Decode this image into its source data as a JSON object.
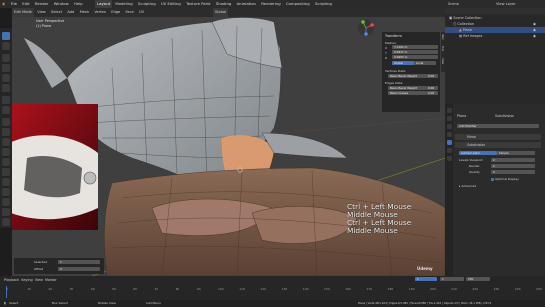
{
  "menu": {
    "items": [
      "File",
      "Edit",
      "Render",
      "Window",
      "Help"
    ],
    "workspaces": [
      "Layout",
      "Modeling",
      "Sculpting",
      "UV Editing",
      "Texture Paint",
      "Shading",
      "Animation",
      "Rendering",
      "Compositing",
      "Scripting"
    ],
    "active_workspace": "Layout",
    "scene": "Scene",
    "view_layer": "View Layer"
  },
  "viewport": {
    "mode": "Edit Mode",
    "header_menus": [
      "View",
      "Select",
      "Add",
      "Mesh",
      "Vertex",
      "Edge",
      "Face",
      "UV"
    ],
    "transform_orientation": "Global",
    "view_title": "User Perspective",
    "object_name": "(1) Plane",
    "overlay_label": "Ortho"
  },
  "npanel": {
    "header": "Transform",
    "median_label": "Median:",
    "axes": [
      {
        "axis": "X",
        "value": "7.2162 m"
      },
      {
        "axis": "Y",
        "value": "0.5637 m"
      },
      {
        "axis": "Z",
        "value": "0.9993 m"
      }
    ],
    "space_buttons": [
      "Global",
      "Local"
    ],
    "active_space": "Global",
    "vertices_header": "Vertices Data:",
    "vertex_field": {
      "label": "Mean Bevel Weight",
      "value": "0.00"
    },
    "edges_header": "Edges Data:",
    "edge_fields": [
      {
        "label": "Mean Bevel Weight",
        "value": "0.00"
      },
      {
        "label": "Mean Crease",
        "value": "0.00"
      }
    ],
    "tabs": [
      "Item",
      "Tool",
      "View"
    ]
  },
  "keystrokes": [
    "Ctrl + Left Mouse",
    "Middle Mouse",
    "Ctrl + Left Mouse",
    "Middle Mouse"
  ],
  "watermark": "Udemy",
  "outliner": {
    "title": "Scene Collection",
    "rows": [
      {
        "name": "Collection",
        "icon": "collection-icon"
      },
      {
        "name": "Plane",
        "icon": "mesh-icon"
      },
      {
        "name": "Ref Images",
        "icon": "image-icon"
      }
    ]
  },
  "properties": {
    "object_name": "Plane",
    "modifier_name": "Subdivision",
    "add_modifier": "Add Modifier",
    "modifiers": [
      {
        "name": "Mirror"
      },
      {
        "name": "Subdivision"
      }
    ],
    "subsurf_buttons": [
      "Catmull-Clark",
      "Simple"
    ],
    "active_subsurf": "Catmull-Clark",
    "levels_viewport": {
      "label": "Levels Viewport",
      "value": "2"
    },
    "render_field": {
      "label": "Render",
      "value": "2"
    },
    "quality_field": {
      "label": "Quality",
      "value": "3"
    },
    "optimal_display": "Optimal Display",
    "advanced": "Advanced"
  },
  "lower_left": {
    "fields": [
      {
        "label": "Selected",
        "value": "1"
      },
      {
        "label": "Offset",
        "value": "0"
      }
    ]
  },
  "timeline": {
    "menus": [
      "Playback",
      "Keying",
      "View",
      "Marker"
    ],
    "frame_ticks": [
      "0",
      "10",
      "20",
      "30",
      "40",
      "50",
      "60",
      "70",
      "80",
      "90",
      "100",
      "110",
      "120",
      "130",
      "140",
      "150",
      "160",
      "170",
      "180",
      "190",
      "200",
      "210",
      "220",
      "230",
      "240",
      "250"
    ],
    "start": "1",
    "end": "250",
    "current": "1"
  },
  "status": {
    "left": "Select",
    "middle": "Box Select",
    "right": "Rotate View",
    "extra": "Call Menu",
    "info": "Plane | Verts:48/1,024 | Edges:0/1,982 | Faces:0/958 | Tris:1,916 | Objects:1/3 | Mem: 46.1 MiB | 2.83.5"
  }
}
